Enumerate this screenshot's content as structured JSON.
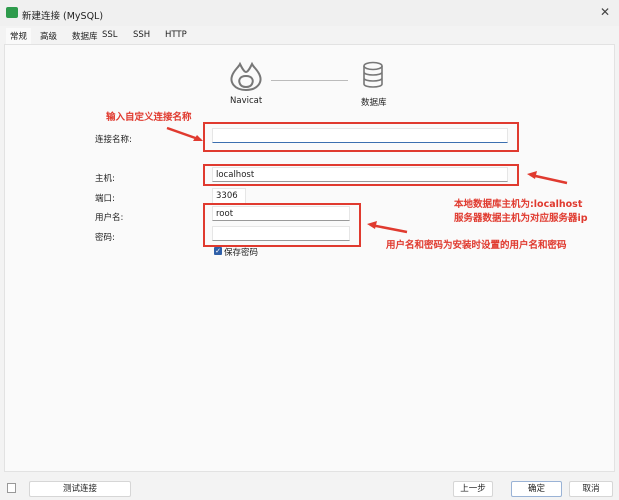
{
  "window": {
    "title": "新建连接 (MySQL)",
    "close": "✕"
  },
  "tabs": [
    "常规",
    "高级",
    "数据库",
    "SSL",
    "SSH",
    "HTTP"
  ],
  "diagram": {
    "left_label": "Navicat",
    "right_label": "数据库"
  },
  "form": {
    "connection_name_label": "连接名称:",
    "connection_name_value": "",
    "host_label": "主机:",
    "host_value": "localhost",
    "port_label": "端口:",
    "port_value": "3306",
    "username_label": "用户名:",
    "username_value": "root",
    "password_label": "密码:",
    "password_value": "",
    "save_password_label": "保存密码",
    "save_password_checked": true
  },
  "annotations": {
    "name_note": "输入自定义连接名称",
    "host_note_1": "本地数据库主机为:localhost",
    "host_note_2": "服务器数据主机为对应服务器ip",
    "user_note": "用户名和密码为安装时设置的用户名和密码"
  },
  "footer": {
    "test": "测试连接",
    "back": "上一步",
    "ok": "确定",
    "cancel": "取消"
  }
}
